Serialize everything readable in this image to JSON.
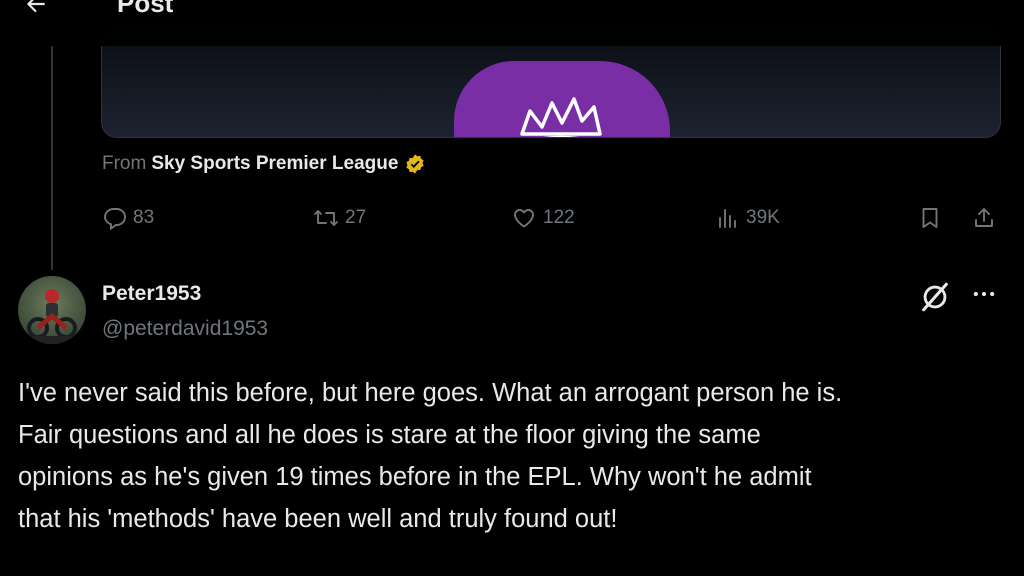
{
  "header": {
    "title": "Post",
    "back_icon": "back-arrow-icon"
  },
  "quoted_media": {
    "description_icon": "premier-league-lion-crown-icon"
  },
  "source": {
    "prefix": "From",
    "name": "Sky Sports Premier League",
    "badge_color": "#e2b719"
  },
  "actions": {
    "replies": "83",
    "reposts": "27",
    "likes": "122",
    "views": "39K"
  },
  "reply": {
    "display_name": "Peter1953",
    "handle": "@peterdavid1953",
    "text_lines": [
      "I've never said this before, but here goes. What an arrogant person he is.",
      "Fair questions and all he does is stare at the floor giving the same",
      "opinions as he's given 19 times before in the EPL. Why won't he admit",
      "that his 'methods' have been well and truly found out!"
    ]
  },
  "colors": {
    "background": "#000000",
    "text": "#e7e9ea",
    "muted": "#71767b",
    "accent_purple": "#7a2ea6"
  }
}
